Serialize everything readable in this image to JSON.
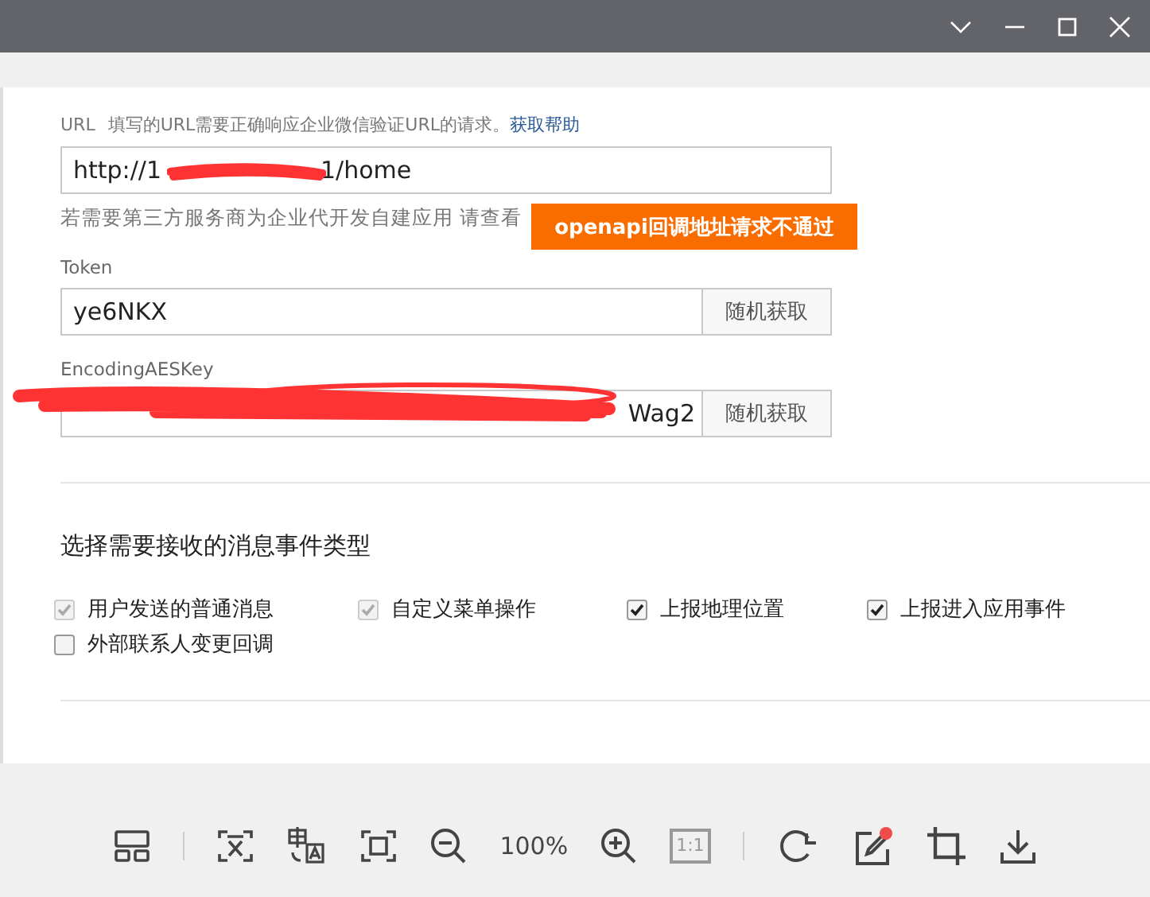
{
  "url": {
    "label": "URL",
    "hint": "填写的URL需要正确响应企业微信验证URL的请求。",
    "help_link": "获取帮助",
    "value_start": "http://1",
    "value_end": "1/home",
    "redacted": true
  },
  "third_party_note": "若需要第三方服务商为企业代开发自建应用 请查看",
  "toast": "openapi回调地址请求不通过",
  "token": {
    "label": "Token",
    "value": "ye6NKX",
    "button": "随机获取"
  },
  "aes_key": {
    "label": "EncodingAESKey",
    "value_end": "Wag2",
    "redacted": true,
    "button": "随机获取"
  },
  "events": {
    "title": "选择需要接收的消息事件类型",
    "options": [
      {
        "label": "用户发送的普通消息",
        "checked": true,
        "disabled": true
      },
      {
        "label": "自定义菜单操作",
        "checked": true,
        "disabled": true
      },
      {
        "label": "上报地理位置",
        "checked": true,
        "disabled": false
      },
      {
        "label": "上报进入应用事件",
        "checked": true,
        "disabled": false
      },
      {
        "label": "外部联系人变更回调",
        "checked": false,
        "disabled": false
      }
    ]
  },
  "viewer_toolbar": {
    "zoom": "100%",
    "actual_size": "1:1",
    "edit_badge": true
  }
}
